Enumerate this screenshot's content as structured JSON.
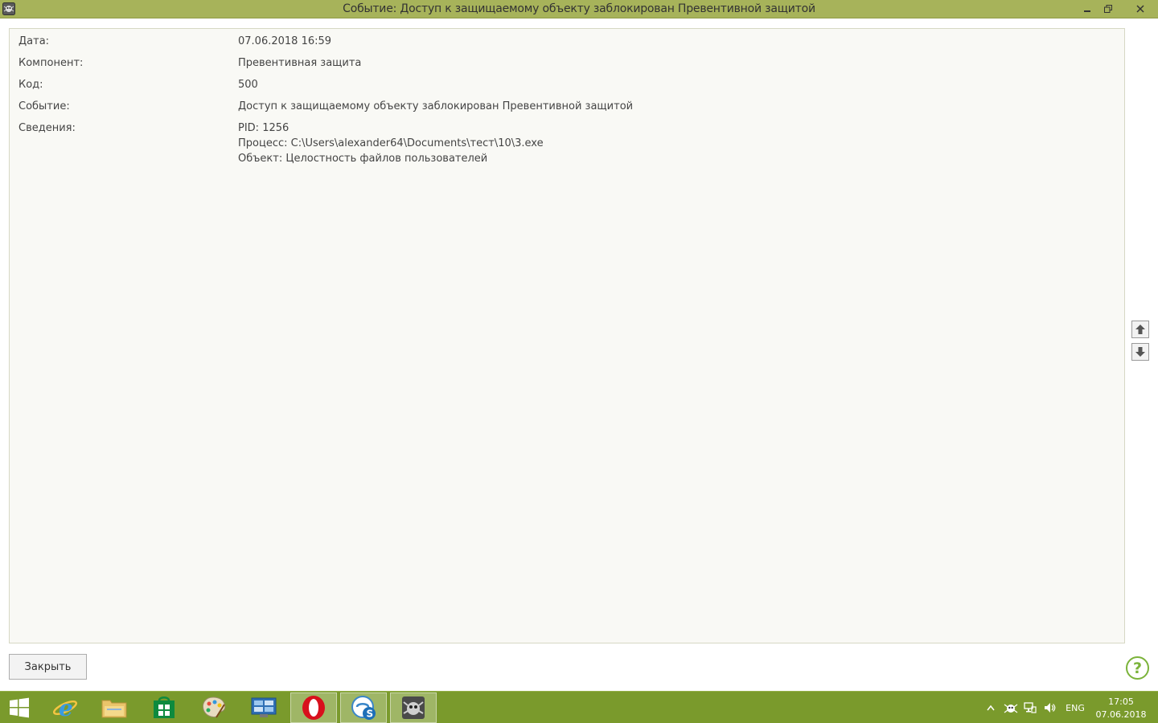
{
  "window": {
    "title": "Событие: Доступ к защищаемому объекту заблокирован Превентивной защитой"
  },
  "details": {
    "rows": [
      {
        "label": "Дата:",
        "value": "07.06.2018 16:59"
      },
      {
        "label": "Компонент:",
        "value": "Превентивная защита"
      },
      {
        "label": "Код:",
        "value": "500"
      },
      {
        "label": "Событие:",
        "value": "Доступ к защищаемому объекту заблокирован Превентивной защитой"
      },
      {
        "label": "Сведения:",
        "lines": [
          "PID: 1256",
          "Процесс: C:\\Users\\alexander64\\Documents\\тест\\10\\3.exe",
          "Объект: Целостность файлов пользователей"
        ]
      }
    ]
  },
  "buttons": {
    "close_label": "Закрыть",
    "help_label": "?"
  },
  "taskbar": {
    "language": "ENG",
    "time": "17:05",
    "date": "07.06.2018",
    "apps": [
      "start",
      "internet-explorer",
      "file-explorer",
      "store",
      "paint",
      "control-panel",
      "opera",
      "skype",
      "dr-web"
    ]
  },
  "colors": {
    "titlebar": "#a7b35a",
    "taskbar": "#7a9a2c",
    "panel_bg": "#f9f9f5",
    "help_accent": "#7bb33a"
  }
}
